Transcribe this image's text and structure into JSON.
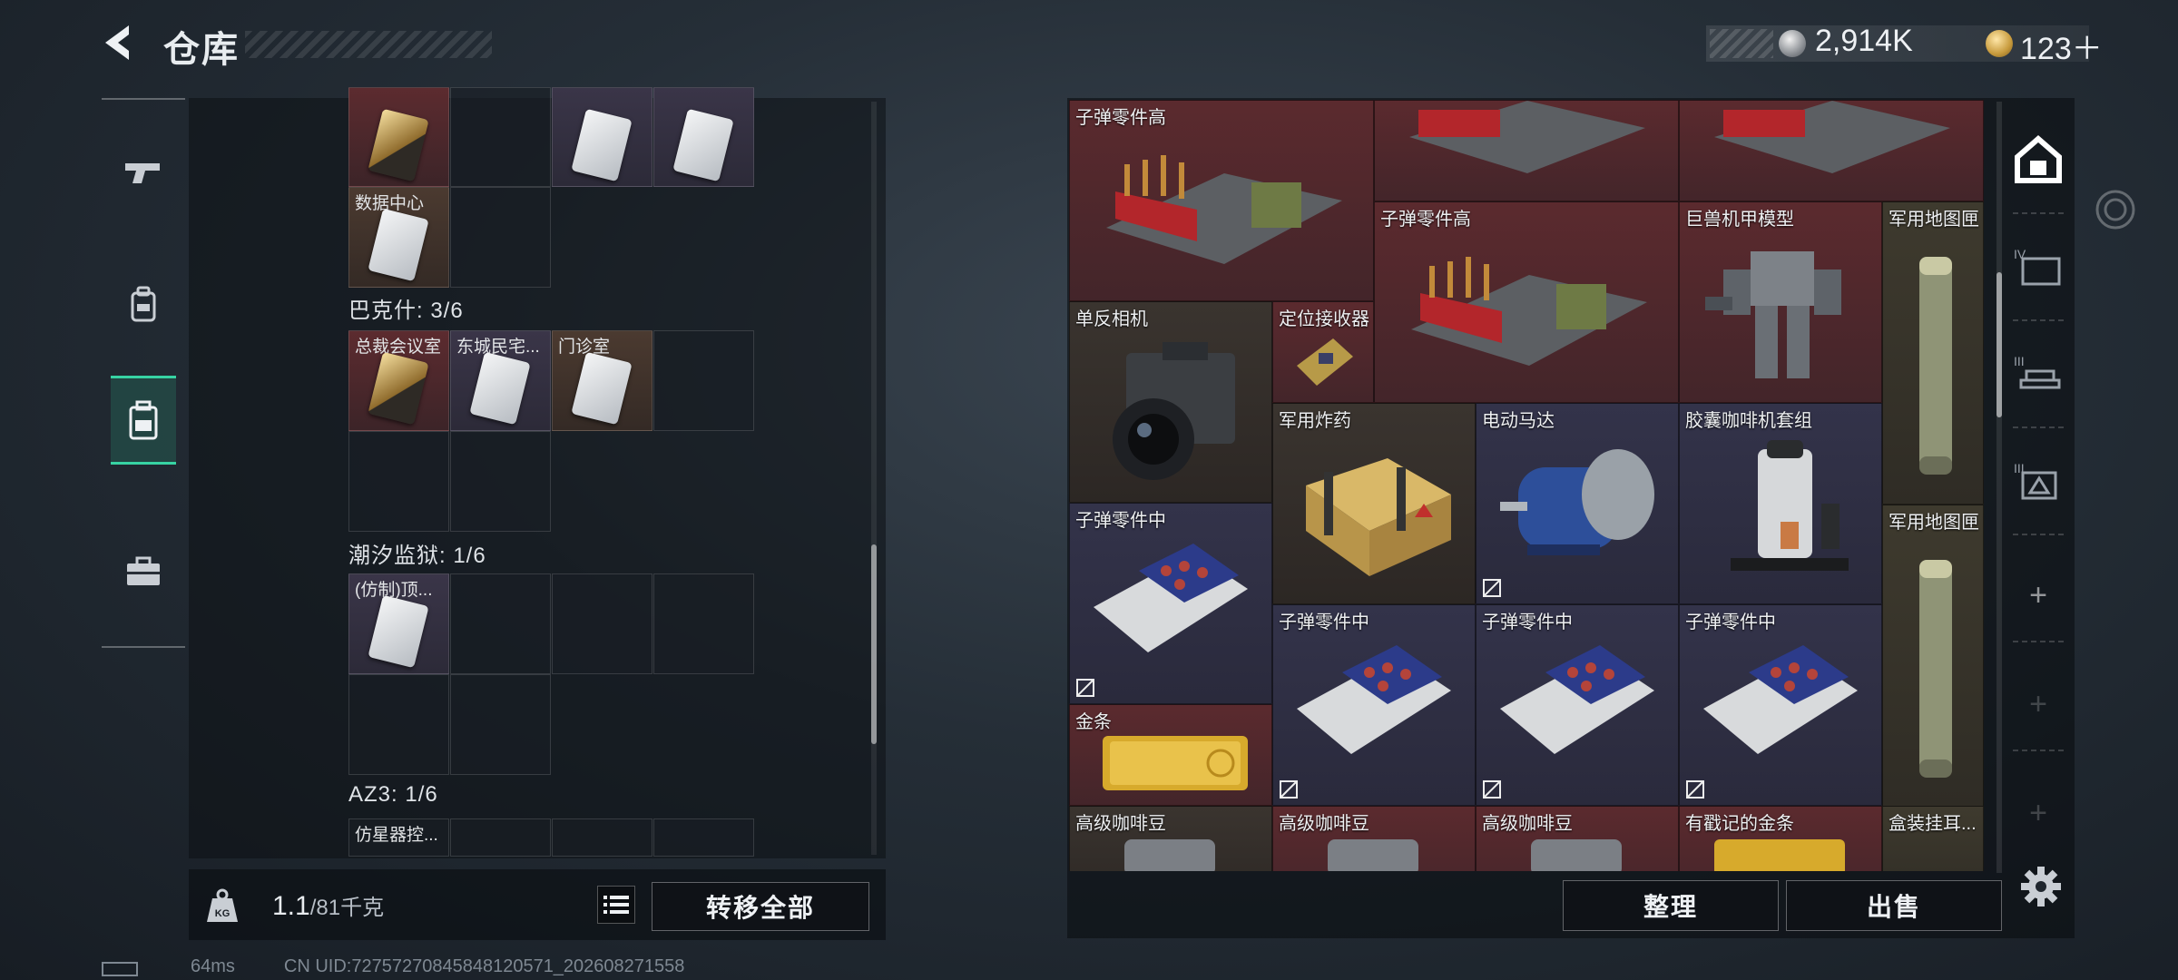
{
  "header": {
    "title": "仓库",
    "currency_silver": "2,914K",
    "currency_gold": "123＋"
  },
  "left_nav": {
    "items": [
      "weapon-icon",
      "gear-bag-icon",
      "backpack-icon",
      "briefcase-icon"
    ],
    "active_index": 2
  },
  "key_groups": {
    "top_partial": {
      "labels": [
        "数据中心"
      ]
    },
    "group1": {
      "label": "巴克什: 3/6",
      "items": [
        "总裁会议室",
        "东城民宅...",
        "门诊室"
      ]
    },
    "group2": {
      "label": "潮汐监狱: 1/6",
      "items": [
        "(仿制)顶..."
      ]
    },
    "group3": {
      "label": "AZ3: 1/6",
      "items": [
        "仿星器控..."
      ]
    }
  },
  "weight": {
    "current": "1.1",
    "max": "/81千克"
  },
  "buttons": {
    "transfer_all": "转移全部",
    "sort": "整理",
    "sell": "出售"
  },
  "status": {
    "ping": "64ms",
    "uid": "CN UID:72757270845848120571_202608271558"
  },
  "inventory_items": [
    {
      "label": "子弹零件高"
    },
    {
      "label": "子弹零件高"
    },
    {
      "label": "巨兽机甲模型"
    },
    {
      "label": "军用地图匣"
    },
    {
      "label": "单反相机"
    },
    {
      "label": "定位接收器"
    },
    {
      "label": "军用炸药"
    },
    {
      "label": "电动马达"
    },
    {
      "label": "胶囊咖啡机套组"
    },
    {
      "label": "子弹零件中"
    },
    {
      "label": "军用地图匣"
    },
    {
      "label": "子弹零件中"
    },
    {
      "label": "子弹零件中"
    },
    {
      "label": "子弹零件中"
    },
    {
      "label": "金条"
    },
    {
      "label": "高级咖啡豆"
    },
    {
      "label": "高级咖啡豆"
    },
    {
      "label": "高级咖啡豆"
    },
    {
      "label": "有戳记的金条"
    },
    {
      "label": "盒装挂耳..."
    }
  ],
  "right_tabs": [
    "safe-box-icon",
    "container-IV-icon",
    "container-III-icon",
    "container-III-b-icon"
  ],
  "colors": {
    "accent": "#37d3a3",
    "cell_gold": "#5c2b2f",
    "cell_purple": "#3a3548"
  }
}
